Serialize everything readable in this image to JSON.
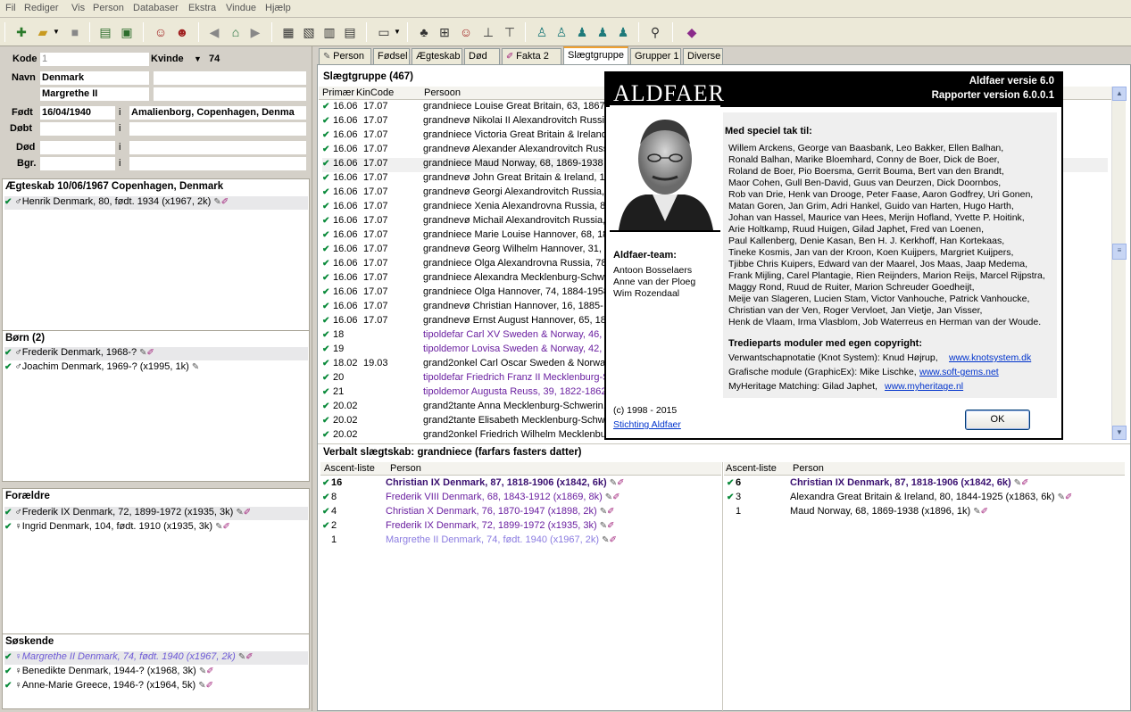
{
  "menu": [
    "Fil",
    "Rediger",
    "Vis",
    "Person",
    "Databaser",
    "Ekstra",
    "Vindue",
    "Hjælp"
  ],
  "toolbar": {
    "icons": [
      "new-file-icon",
      "open-folder-icon",
      "dropdown-icon",
      "stop-icon",
      "import-icon",
      "export-icon",
      "male-face-icon",
      "female-face-icon",
      "back-arrow-icon",
      "home-icon",
      "forward-arrow-icon",
      "list-view-icon",
      "family-view-icon",
      "card-view-icon",
      "report-view-icon",
      "window-icon",
      "tree-icon",
      "tree-2-icon",
      "portrait-icon",
      "descendants-icon",
      "pedigree-icon",
      "person-icon",
      "person-2-icon",
      "couple-icon",
      "family-icon",
      "children-icon",
      "search-icon",
      "book-icon"
    ]
  },
  "person": {
    "kode_label": "Kode",
    "kode_value": "1",
    "sex_label": "Kvinde",
    "id": "74",
    "navn_label": "Navn",
    "surname": "Denmark",
    "firstname": "Margrethe II",
    "fodt_label": "Født",
    "fodt_date": "16/04/1940",
    "fodt_i": "i",
    "fodt_place": "Amalienborg, Copenhagen, Denma",
    "dobt_label": "Døbt",
    "dobt_i": "i",
    "dod_label": "Død",
    "dod_i": "i",
    "bgr_label": "Bgr.",
    "bgr_i": "i"
  },
  "marriage": {
    "title": "Ægteskab 10/06/1967 Copenhagen, Denmark",
    "rows": [
      {
        "sym": "♂",
        "text": "Henrik Denmark, 80, født. 1934 (x1967, 2k)"
      }
    ]
  },
  "children": {
    "title": "Børn (2)",
    "rows": [
      {
        "sym": "♂",
        "text": "Frederik Denmark, 1968-?"
      },
      {
        "sym": "♂",
        "text": "Joachim Denmark, 1969-? (x1995, 1k)"
      }
    ]
  },
  "parents": {
    "title": "Forældre",
    "rows": [
      {
        "sym": "♂",
        "text": "Frederik IX Denmark, 72, 1899-1972 (x1935, 3k)"
      },
      {
        "sym": "♀",
        "text": "Ingrid Denmark, 104, født. 1910 (x1935, 3k)"
      }
    ]
  },
  "siblings": {
    "title": "Søskende",
    "rows": [
      {
        "sym": "♀",
        "text": "Margrethe II Denmark, 74, født. 1940 (x1967, 2k)"
      },
      {
        "sym": "♀",
        "text": "Benedikte Denmark, 1944-? (x1968, 3k)"
      },
      {
        "sym": "♀",
        "text": "Anne-Marie Greece, 1946-? (x1964, 5k)"
      }
    ]
  },
  "tabs": [
    "Person",
    "Fødsel",
    "Ægteskab",
    "Død",
    "Fakta 2",
    "Slægtgruppe",
    "Grupper 1",
    "Diverse"
  ],
  "kin": {
    "title": "Slægtgruppe (467)",
    "col_primaer": "Primær",
    "col_kincode": "KinCode",
    "col_person": "Persoon",
    "rows": [
      {
        "p": "16.06",
        "k": "17.07",
        "t": "grandniece Louise Great Britain, 63, 1867-",
        "purple": false
      },
      {
        "p": "16.06",
        "k": "17.07",
        "t": "grandnevø Nikolai II Alexandrovitch Russia",
        "purple": false
      },
      {
        "p": "16.06",
        "k": "17.07",
        "t": "grandniece Victoria Great Britain & Ireland,",
        "purple": false
      },
      {
        "p": "16.06",
        "k": "17.07",
        "t": "grandnevø Alexander Alexandrovitch Russia",
        "purple": false
      },
      {
        "p": "16.06",
        "k": "17.07",
        "t": "grandniece Maud Norway, 68, 1869-1938",
        "purple": false
      },
      {
        "p": "16.06",
        "k": "17.07",
        "t": "grandnevø John Great Britain & Ireland, 1",
        "purple": false
      },
      {
        "p": "16.06",
        "k": "17.07",
        "t": "grandnevø Georgi Alexandrovitch Russia,",
        "purple": false
      },
      {
        "p": "16.06",
        "k": "17.07",
        "t": "grandniece Xenia Alexandrovna Russia, 85",
        "purple": false
      },
      {
        "p": "16.06",
        "k": "17.07",
        "t": "grandnevø Michail Alexandrovitch Russia,",
        "purple": false
      },
      {
        "p": "16.06",
        "k": "17.07",
        "t": "grandniece Marie Louise Hannover, 68, 18",
        "purple": false
      },
      {
        "p": "16.06",
        "k": "17.07",
        "t": "grandnevø Georg Wilhelm Hannover, 31, 1",
        "purple": false
      },
      {
        "p": "16.06",
        "k": "17.07",
        "t": "grandniece Olga Alexandrovna Russia, 78,",
        "purple": false
      },
      {
        "p": "16.06",
        "k": "17.07",
        "t": "grandniece Alexandra Mecklenburg-Schwe",
        "purple": false
      },
      {
        "p": "16.06",
        "k": "17.07",
        "t": "grandniece Olga Hannover, 74, 1884-1958",
        "purple": false
      },
      {
        "p": "16.06",
        "k": "17.07",
        "t": "grandnevø Christian Hannover, 16, 1885-",
        "purple": false
      },
      {
        "p": "16.06",
        "k": "17.07",
        "t": "grandnevø Ernst August Hannover, 65, 18",
        "purple": false
      },
      {
        "p": "18",
        "k": "",
        "t": "tipoldefar Carl XV Sweden & Norway, 46, 1",
        "purple": true
      },
      {
        "p": "19",
        "k": "",
        "t": "tipoldemor Lovisa Sweden & Norway, 42, 1",
        "purple": true
      },
      {
        "p": "18.02",
        "k": "19.03",
        "t": "grand2onkel Carl Oscar Sweden & Norway",
        "purple": false
      },
      {
        "p": "20",
        "k": "",
        "t": "tipoldefar Friedrich Franz II Mecklenburg-S",
        "purple": true
      },
      {
        "p": "21",
        "k": "",
        "t": "tipoldemor Augusta Reuss, 39, 1822-1862",
        "purple": true
      },
      {
        "p": "20.02",
        "k": "",
        "t": "grand2tante Anna Mecklenburg-Schwerin,",
        "purple": false
      },
      {
        "p": "20.02",
        "k": "",
        "t": "grand2tante Elisabeth Mecklenburg-Schwe",
        "purple": false
      },
      {
        "p": "20.02",
        "k": "",
        "t": "grand2onkel Friedrich Wilhelm Mecklenbur",
        "purple": false
      }
    ]
  },
  "verbal": {
    "title": "Verbalt slægtskab: grandniece (farfars fasters datter)",
    "col_ascent": "Ascent-liste",
    "col_person": "Person",
    "left": [
      {
        "n": "16",
        "t": "Christian IX Denmark, 87, 1818-1906 (x1842, 6k)",
        "style": "bold"
      },
      {
        "n": "8",
        "t": "Frederik VIII Denmark, 68, 1843-1912 (x1869, 8k)",
        "style": "purple"
      },
      {
        "n": "4",
        "t": "Christian X Denmark, 76, 1870-1947 (x1898, 2k)",
        "style": "purple"
      },
      {
        "n": "2",
        "t": "Frederik IX Denmark, 72, 1899-1972 (x1935, 3k)",
        "style": "purple"
      },
      {
        "n": "1",
        "t": "Margrethe II Denmark, 74, født. 1940 (x1967, 2k)",
        "style": "light"
      }
    ],
    "right": [
      {
        "n": "6",
        "t": "Christian IX Denmark, 87, 1818-1906 (x1842, 6k)",
        "style": "bold"
      },
      {
        "n": "3",
        "t": "Alexandra Great Britain & Ireland, 80, 1844-1925 (x1863, 6k)",
        "style": "normal"
      },
      {
        "n": "1",
        "t": "Maud Norway, 68, 1869-1938 (x1896, 1k)",
        "style": "normal"
      }
    ]
  },
  "about": {
    "logo": "ALDFAER",
    "version": "Aldfaer versie 6.0",
    "report_version": "Rapporter version 6.0.0.1",
    "thanks_title": "Med speciel tak til:",
    "thanks_lines": [
      "Willem Arckens, George van Baasbank, Leo Bakker, Ellen Balhan,",
      "Ronald Balhan, Marike Bloemhard, Conny de Boer, Dick de Boer,",
      "Roland de Boer, Pio Boersma, Gerrit Bouma, Bert van den Brandt,",
      "Maor Cohen, Gull Ben-David, Guus van Deurzen, Dick Doornbos,",
      "Rob van Drie, Henk van Drooge, Peter Faase, Aaron Godfrey, Uri Gonen,",
      "Matan Goren, Jan Grim, Adri Hankel, Guido van Harten, Hugo Harth,",
      "Johan van Hassel, Maurice van Hees, Merijn Hofland, Yvette P. Hoitink,",
      "Arie Holtkamp, Ruud Huigen, Gilad Japhet, Fred van Loenen,",
      "Paul Kallenberg, Denie Kasan, Ben H. J. Kerkhoff, Han Kortekaas,",
      "Tineke Kosmis, Jan van der Kroon, Koen Kuijpers, Margriet Kuijpers,",
      "Tjibbe Chris Kuipers, Edward van der Maarel, Jos Maas, Jaap Medema,",
      "Frank Mijling, Carel Plantagie, Rien Reijnders, Marion Reijs, Marcel Rijpstra,",
      "Maggy Rond, Ruud de Ruiter, Marion Schreuder Goedheijt,",
      "Meije van Slageren, Lucien Stam, Victor Vanhouche, Patrick Vanhoucke,",
      "Christian van der Ven, Roger Vervloet, Jan Vietje, Jan Visser,",
      "Henk de Vlaam, Irma Vlasblom, Job Waterreus en Herman van der Woude."
    ],
    "third_title": "Tredieparts moduler med egen copyright:",
    "third": [
      {
        "text": "Verwantschapnotatie (Knot System): Knud Højrup,",
        "link": "www.knotsystem.dk"
      },
      {
        "text": "Grafische module (GraphicEx): Mike Lischke,",
        "link": "www.soft-gems.net"
      },
      {
        "text": "MyHeritage Matching: Gilad Japhet,",
        "link": "www.myheritage.nl"
      }
    ],
    "team_title": "Aldfaer-team:",
    "team": [
      "Antoon Bosselaers",
      "Anne van der Ploeg",
      "Wim Rozendaal"
    ],
    "copyright": "(c) 1998 - 2015",
    "foundation_link": "Stichting Aldfaer",
    "ok": "OK"
  }
}
